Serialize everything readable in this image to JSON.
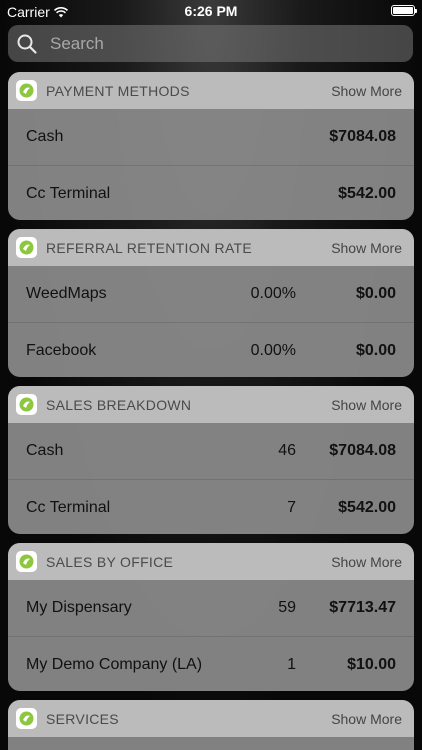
{
  "status_bar": {
    "carrier": "Carrier",
    "time": "6:26 PM"
  },
  "search": {
    "placeholder": "Search"
  },
  "accent_color": "#8dc63f",
  "widgets": [
    {
      "title": "PAYMENT METHODS",
      "show_more": "Show More",
      "rows": [
        {
          "label": "Cash",
          "mid": "",
          "value": "$7084.08"
        },
        {
          "label": "Cc Terminal",
          "mid": "",
          "value": "$542.00"
        }
      ]
    },
    {
      "title": "REFERRAL RETENTION RATE",
      "show_more": "Show More",
      "rows": [
        {
          "label": "WeedMaps",
          "mid": "0.00%",
          "value": "$0.00"
        },
        {
          "label": "Facebook",
          "mid": "0.00%",
          "value": "$0.00"
        }
      ]
    },
    {
      "title": "SALES BREAKDOWN",
      "show_more": "Show More",
      "rows": [
        {
          "label": "Cash",
          "mid": "46",
          "value": "$7084.08"
        },
        {
          "label": "Cc Terminal",
          "mid": "7",
          "value": "$542.00"
        }
      ]
    },
    {
      "title": "SALES BY OFFICE",
      "show_more": "Show More",
      "rows": [
        {
          "label": "My Dispensary",
          "mid": "59",
          "value": "$7713.47"
        },
        {
          "label": "My Demo Company (LA)",
          "mid": "1",
          "value": "$10.00"
        }
      ]
    },
    {
      "title": "SERVICES",
      "show_more": "Show More",
      "rows": []
    }
  ]
}
